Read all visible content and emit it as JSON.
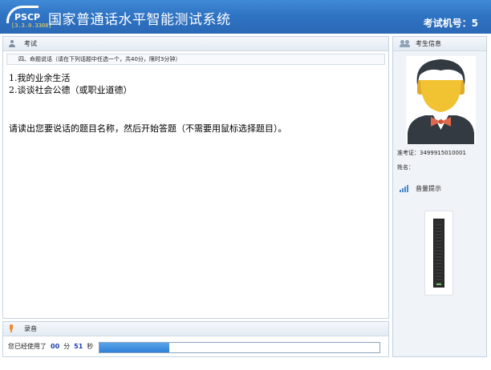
{
  "header": {
    "logo_text": "PSCP",
    "version": "[3.3.0.3308]",
    "title": "国家普通话水平智能测试系统",
    "exam_no_label": "考试机号：",
    "exam_no": "5"
  },
  "main": {
    "panel_title": "考试",
    "section": "四、命题说话（请在下列话题中任选一个，共40分，限时3分钟）",
    "topics": [
      "1.我的业余生活",
      "2.谈谈社会公德（或职业道德）"
    ],
    "instruction": "请读出您要说话的题目名称，然后开始答题（不需要用鼠标选择题目）。"
  },
  "recording": {
    "title": "录音",
    "used_label": "您已经使用了",
    "minutes": "00",
    "min_unit": "分",
    "seconds": "51",
    "sec_unit": "秒",
    "progress": 0.25
  },
  "candidate": {
    "panel_title": "考生信息",
    "ticket_label": "准考证：",
    "ticket_no": "3499915010001",
    "name_label": "姓名：",
    "name": "",
    "volume_title": "音量提示",
    "volume_level": 0.02
  },
  "colors": {
    "header": "#2f74c4",
    "accent": "#2f7fd6",
    "version": "#ffd84a",
    "tie": "#e0694c",
    "face": "#f1c232"
  }
}
